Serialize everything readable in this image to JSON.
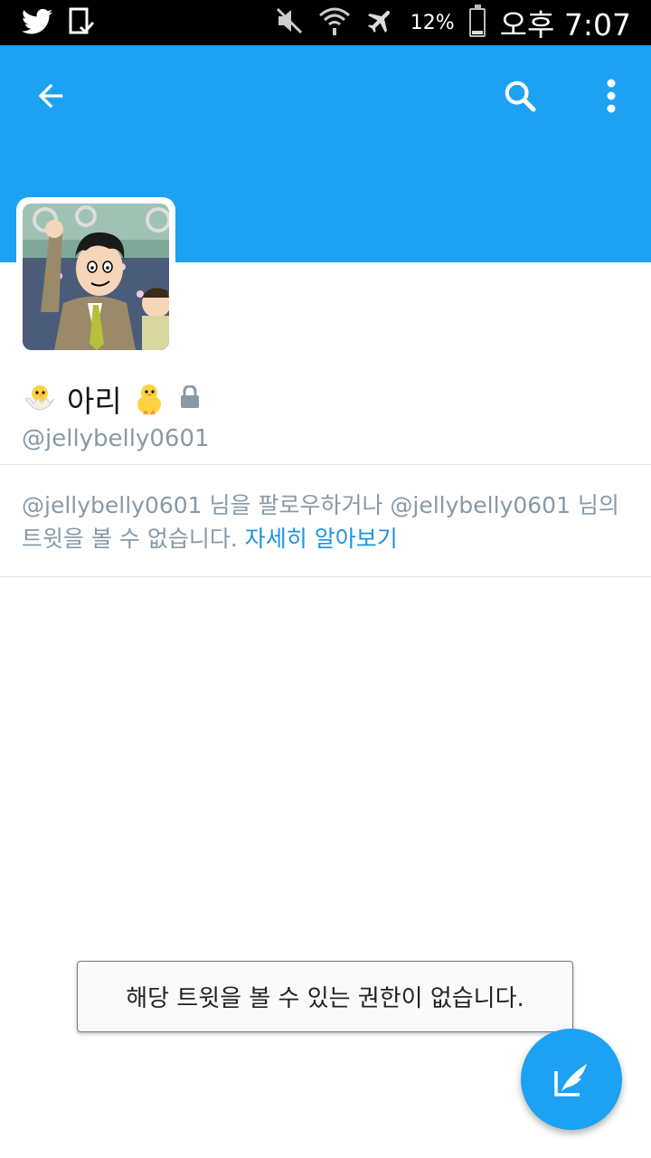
{
  "status_bar": {
    "battery": "12%",
    "clock": "오후 7:07",
    "icons": [
      "twitter-icon",
      "download-check-icon",
      "mute-icon",
      "wifi-icon",
      "airplane-icon",
      "battery-icon"
    ]
  },
  "app_bar": {
    "color": "#1da1f2",
    "icons": [
      "back-arrow-icon",
      "search-icon",
      "more-vertical-icon"
    ]
  },
  "profile": {
    "display_name": "아리",
    "handle": "@jellybelly0601",
    "protected": true
  },
  "protected_message": {
    "line1": "@jellybelly0601 님을 팔로우하거나 @jellybelly0601 님의",
    "line2_text": "트윗을 볼 수 없습니다. ",
    "learn_more": "자세히 알아보기"
  },
  "toast": {
    "text": "해당 트윗을 볼 수 있는 권한이 없습니다."
  },
  "fab": {
    "icon": "compose-tweet-icon",
    "color": "#1da1f2"
  }
}
